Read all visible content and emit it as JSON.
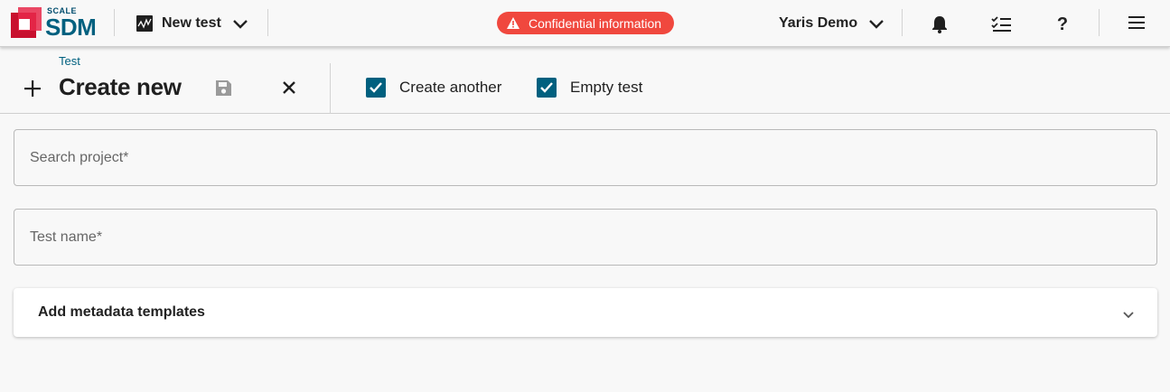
{
  "brand": {
    "top": "SCALE",
    "name": "SDM"
  },
  "header": {
    "project_label": "New test",
    "banner": "Confidential information",
    "user_label": "Yaris Demo"
  },
  "toolbar": {
    "breadcrumb": "Test",
    "title": "Create new",
    "checkboxes": [
      {
        "label": "Create another",
        "checked": true
      },
      {
        "label": "Empty test",
        "checked": true
      }
    ]
  },
  "form": {
    "search_project_placeholder": "Search project*",
    "search_project_value": "",
    "test_name_placeholder": "Test name*",
    "test_name_value": "",
    "metadata_label": "Add metadata templates"
  },
  "colors": {
    "accent": "#00607f",
    "brand_red": "#c8102e",
    "banner": "#f0483e",
    "background": "#f8f8f8"
  },
  "icons": [
    "chart-icon",
    "chevron-down-icon",
    "warning-icon",
    "bell-icon",
    "checklist-icon",
    "help-icon",
    "menu-icon",
    "plus-icon",
    "save-icon",
    "close-icon",
    "check-icon"
  ]
}
